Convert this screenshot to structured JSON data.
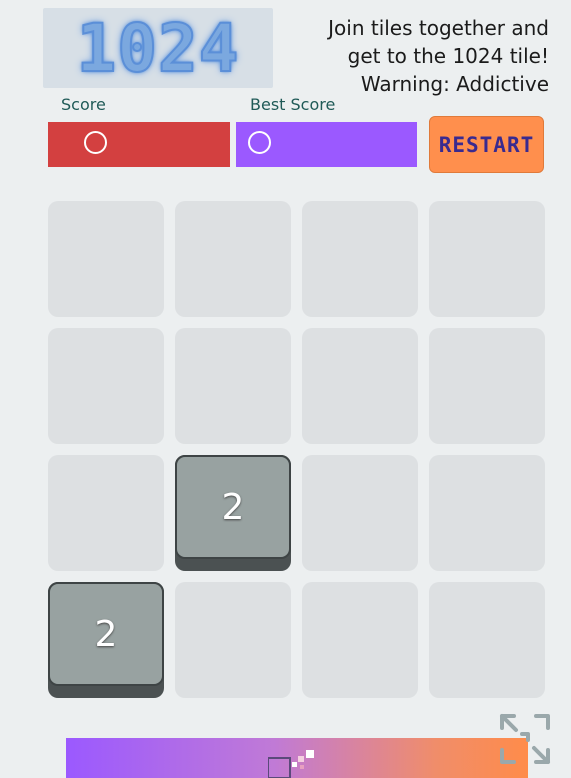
{
  "header": {
    "logo_text": "1024",
    "tagline": [
      "Join tiles together and",
      "get to the 1024 tile!",
      "Warning: Addictive"
    ]
  },
  "scores": {
    "score_label": "Score",
    "score_value": "0",
    "best_label": "Best Score",
    "best_value": "0",
    "score_color": "#d34040",
    "best_color": "#9b59ff"
  },
  "restart_label": "RESTART",
  "board": {
    "rows": [
      [
        "",
        "",
        "",
        ""
      ],
      [
        "",
        "",
        "",
        ""
      ],
      [
        "",
        "2",
        "",
        ""
      ],
      [
        "2",
        "",
        "",
        ""
      ]
    ]
  },
  "icons": {
    "fullscreen": "expand-arrows-icon",
    "bar": "puzzle-pieces-icon"
  }
}
